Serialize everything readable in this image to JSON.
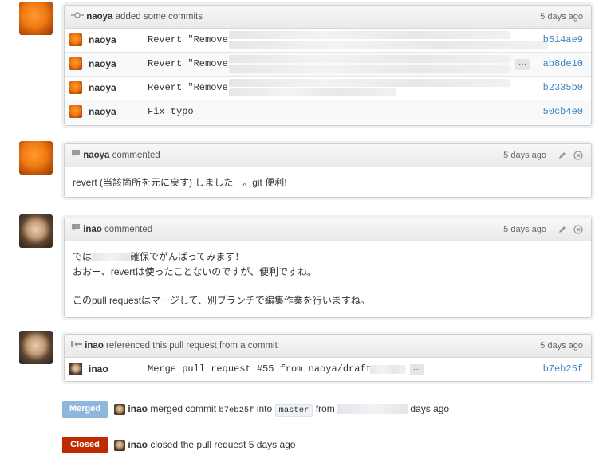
{
  "commits_event": {
    "actor": "naoya",
    "action": "added some commits",
    "time": "5 days ago",
    "rows": [
      {
        "author": "naoya",
        "message": "Revert \"Remove",
        "sha": "b514ae9"
      },
      {
        "author": "naoya",
        "message": "Revert \"Remove",
        "sha": "ab8de10",
        "more": "···"
      },
      {
        "author": "naoya",
        "message": "Revert \"Remove",
        "sha": "b2335b0"
      },
      {
        "author": "naoya",
        "message": "Fix typo",
        "sha": "50cb4e0"
      }
    ]
  },
  "comment1": {
    "author": "naoya",
    "action": "commented",
    "time": "5 days ago",
    "body": "revert (当該箇所を元に戻す) しましたー。git 便利!"
  },
  "comment2": {
    "author": "inao",
    "action": "commented",
    "time": "5 days ago",
    "line1_prefix": "では",
    "line1_suffix": "確保でがんばってみます！",
    "line2": "おおー、revertは使ったことないのですが、便利ですね。",
    "line3": "このpull requestはマージして、別ブランチで編集作業を行いますね。"
  },
  "reference": {
    "actor": "inao",
    "action": "referenced this pull request from a commit",
    "time": "5 days ago",
    "row": {
      "author": "inao",
      "message": "Merge pull request #55 from naoya/draft",
      "sha": "b7eb25f",
      "more": "···"
    }
  },
  "merged": {
    "label": "Merged",
    "actor": "inao",
    "text1": "merged commit",
    "sha": "b7eb25f",
    "text2": "into",
    "branch": "master",
    "text3": "from",
    "text4": "days ago",
    "color": "#8fb6dc"
  },
  "closed": {
    "label": "Closed",
    "actor": "inao",
    "text": "closed the pull request 5 days ago",
    "color": "#bd2c00"
  }
}
